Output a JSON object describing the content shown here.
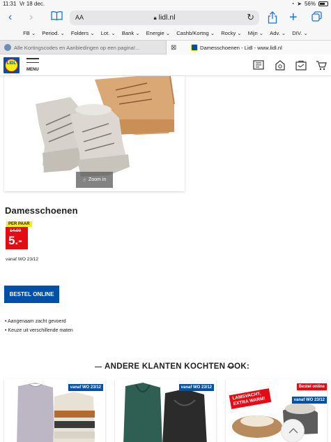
{
  "status": {
    "time": "11:31",
    "date": "Vr 18 dec.",
    "battery": "56%"
  },
  "browser": {
    "text_size": "AA",
    "url": "lidl.nl",
    "bookmarks": [
      "FB ⌄",
      "Period. ⌄",
      "Folders ⌄",
      "Lot. ⌄",
      "Bank ⌄",
      "Energie ⌄",
      "Cashb/Kortng ⌄",
      "Rocky ⌄",
      "Mijn ⌄",
      "Adv. ⌄",
      "DIV. ⌄"
    ],
    "tabs": [
      {
        "label": "Alle Kortingscodes en Aanbiedingen op een pagina!..."
      },
      {
        "label": "Damesschoenen - Lidl - www.lidl.nl"
      }
    ]
  },
  "header": {
    "logo_text": "LIDL",
    "menu_label": "MENU"
  },
  "product": {
    "zoom_label": "Zoom in",
    "title": "Damesschoenen",
    "price_tag": "PER PAAR",
    "old_price": "14.99",
    "price": "5.-",
    "availability": "vanaf WO 23/12",
    "order_button": "BESTEL ONLINE",
    "features": [
      "Aangenaam zacht gevoerd",
      "Keuze uit verschillende maten"
    ]
  },
  "recommendations": {
    "heading": "ANDERE KLANTEN KOCHTEN OOK:",
    "cards": [
      {
        "badge": "vanaf WO 23/12"
      },
      {
        "badge": "vanaf WO 23/12"
      },
      {
        "badge_red": "Bestel online",
        "badge": "vanaf WO 23/12",
        "sticker": "LAMSVACHT, EXTRA WARM!"
      }
    ]
  },
  "colors": {
    "lidl_blue": "#0050aa",
    "lidl_red": "#e60a14",
    "lidl_yellow": "#fff000",
    "ios_blue": "#1a73e8"
  }
}
